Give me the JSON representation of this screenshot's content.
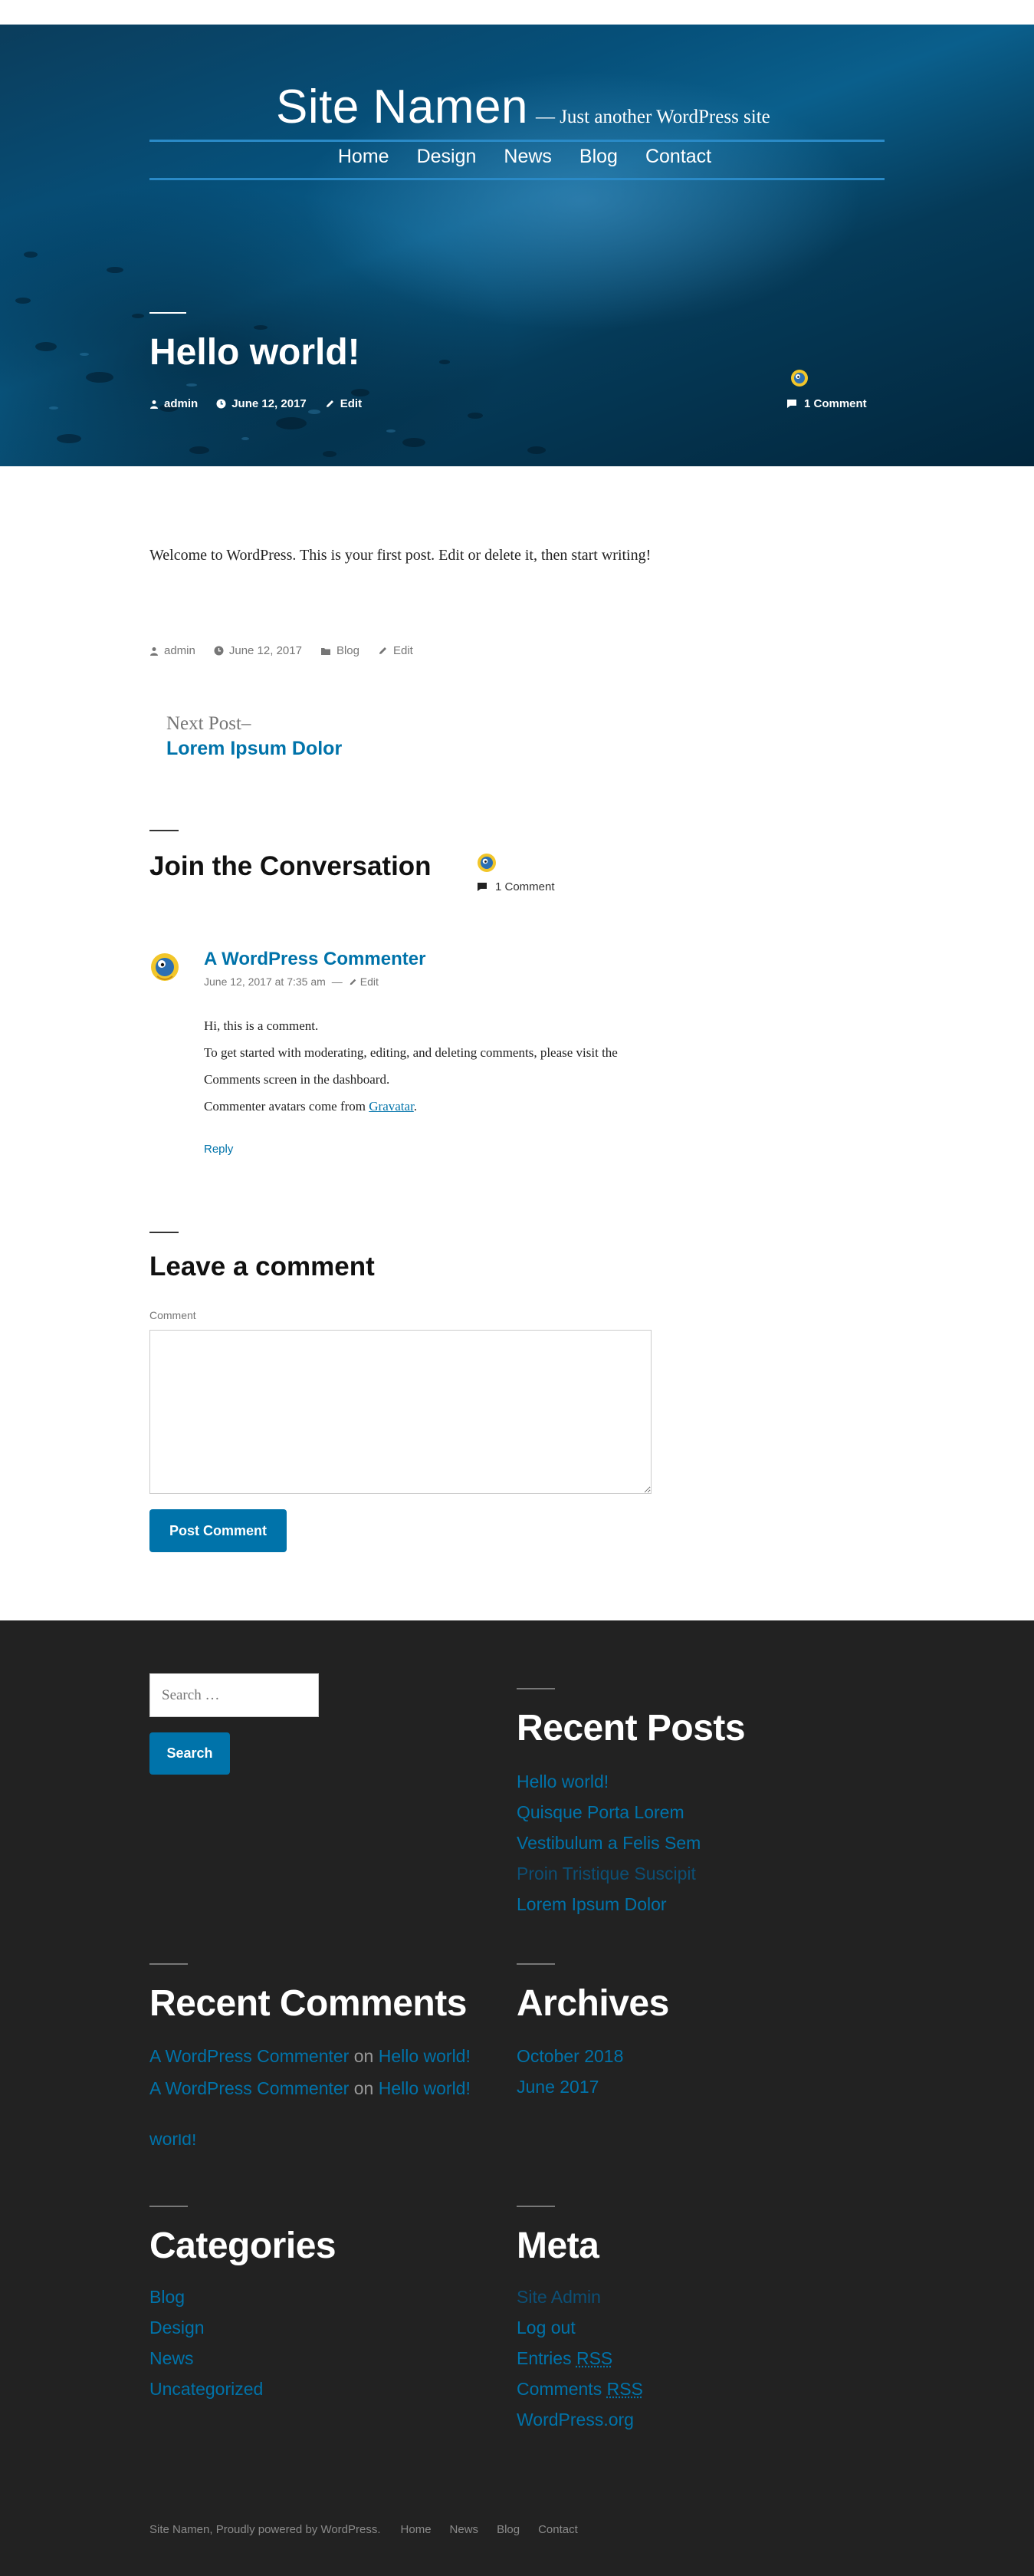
{
  "site": {
    "title": "Site Namen",
    "description": "— Just another WordPress site"
  },
  "nav": [
    "Home",
    "Design",
    "News",
    "Blog",
    "Contact"
  ],
  "post": {
    "title": "Hello world!",
    "author": "admin",
    "date": "June 12, 2017",
    "edit": "Edit",
    "comments_link": "1 Comment",
    "category": "Blog",
    "body": "Welcome to WordPress. This is your first post. Edit or delete it, then start writing!"
  },
  "next_post": {
    "label": "Next Post–",
    "title": "Lorem Ipsum Dolor"
  },
  "comments": {
    "heading": "Join the Conversation",
    "count": "1 Comment",
    "items": [
      {
        "author": "A WordPress Commenter",
        "date": "June 12, 2017 at 7:35 am",
        "separator": "—",
        "edit": "Edit",
        "lines": [
          "Hi, this is a comment.",
          "To get started with moderating, editing, and deleting comments, please visit the Comments screen in the dashboard.",
          "Commenter avatars come from"
        ],
        "link_text": "Gravatar",
        "link_suffix": ".",
        "reply": "Reply"
      }
    ]
  },
  "respond": {
    "heading": "Leave a comment",
    "label": "Comment",
    "submit": "Post Comment"
  },
  "footer": {
    "search": {
      "placeholder": "Search …",
      "button": "Search"
    },
    "recent_posts": {
      "title": "Recent Posts",
      "items": [
        "Hello world!",
        "Quisque Porta Lorem",
        "Vestibulum a Felis Sem",
        "Proin Tristique Suscipit",
        "Lorem Ipsum Dolor"
      ]
    },
    "recent_comments": {
      "title": "Recent Comments",
      "items": [
        {
          "author": "A WordPress Commenter",
          "on": "on",
          "post": "Hello world!"
        },
        {
          "author": "A WordPress Commenter",
          "on": "on",
          "post": "Hello world!"
        }
      ],
      "ghost": "world!"
    },
    "archives": {
      "title": "Archives",
      "items": [
        "October 2018",
        "June 2017"
      ]
    },
    "categories": {
      "title": "Categories",
      "items": [
        "Blog",
        "Design",
        "News",
        "Uncategorized"
      ]
    },
    "meta": {
      "title": "Meta",
      "items": {
        "site_admin": "Site Admin",
        "log_out": "Log out",
        "entries": "Entries",
        "comments": "Comments",
        "rss": "RSS",
        "wordpress_org": "WordPress.org"
      }
    },
    "site_info": {
      "credit": "Site Namen, Proudly powered by WordPress.",
      "links": [
        "Home",
        "News",
        "Blog",
        "Contact"
      ]
    }
  },
  "colors": {
    "accent": "#0073aa",
    "footer_bg": "#222222",
    "hero": "#06507a"
  }
}
